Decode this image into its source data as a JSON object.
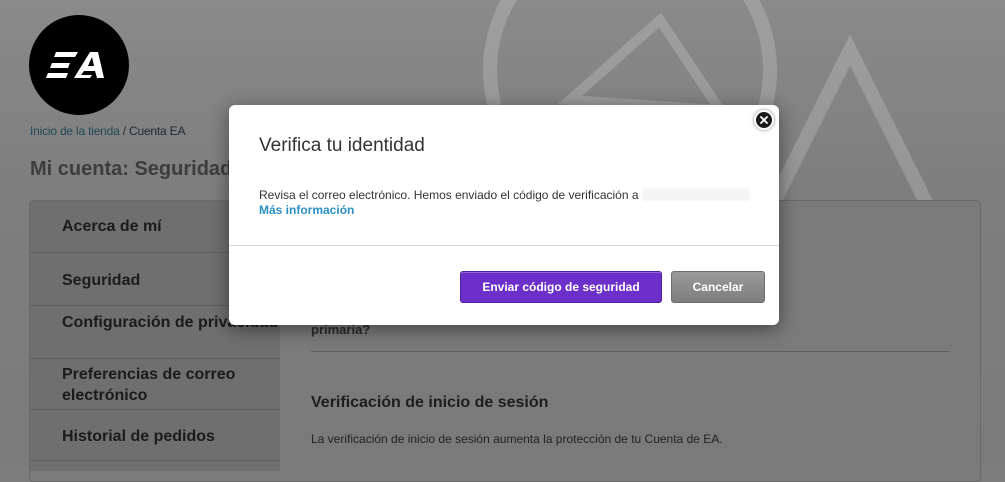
{
  "logo": {
    "text": "EA"
  },
  "breadcrumb": {
    "store_home": "Inicio de la tienda",
    "separator": " / ",
    "current": "Cuenta EA"
  },
  "page_title": "Mi cuenta: Seguridad",
  "sidebar": {
    "items": [
      {
        "label": "Acerca de mí"
      },
      {
        "label": "Seguridad"
      },
      {
        "label": "Configuración de privacidad"
      },
      {
        "label": "Preferencias de correo electrónico"
      },
      {
        "label": "Historial de pedidos"
      }
    ]
  },
  "content": {
    "partial_text": "primaria?",
    "login_verification_heading": "Verificación de inicio de sesión",
    "login_verification_text": "La verificación de inicio de sesión aumenta la protección de tu Cuenta de EA."
  },
  "modal": {
    "title": "Verifica tu identidad",
    "body": "Revisa el correo electrónico. Hemos enviado el código de verificación a",
    "more_info": "Más información",
    "send_button": "Enviar código de seguridad",
    "cancel_button": "Cancelar"
  },
  "colors": {
    "primary_button": "#6c2fc9",
    "link": "#2a8fc1",
    "overlay": "#7c7c7c"
  }
}
